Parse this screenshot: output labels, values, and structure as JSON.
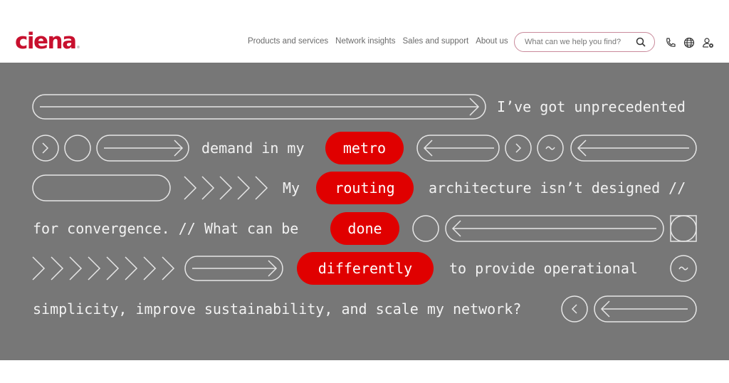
{
  "header": {
    "logo": "ciena",
    "logo_mark": "®",
    "brand_color": "#c8102e",
    "nav": [
      "Products and services",
      "Network insights",
      "Sales and support",
      "About us"
    ],
    "search": {
      "placeholder": "What can we help you find?",
      "value": "",
      "icon": "search-icon"
    },
    "icons": [
      "phone-icon",
      "globe-icon",
      "user-settings-icon"
    ]
  },
  "hero": {
    "background": "#777777",
    "highlight_color": "#e00000",
    "lines": {
      "l1": "I’ve got unprecedented",
      "l2a": "demand in my",
      "l2_pill": "metro",
      "l3a": "My",
      "l3_pill": "routing",
      "l3b": "architecture isn’t designed //",
      "l4a": "for convergence. // What can be",
      "l4_pill": "done",
      "l5_pill": "differently",
      "l5b": "to provide operational",
      "l6a": "simplicity, improve sustainability, and scale my network?"
    },
    "glyphs": {
      "gt": ">",
      "lt": "<",
      "tilde": "~"
    }
  }
}
